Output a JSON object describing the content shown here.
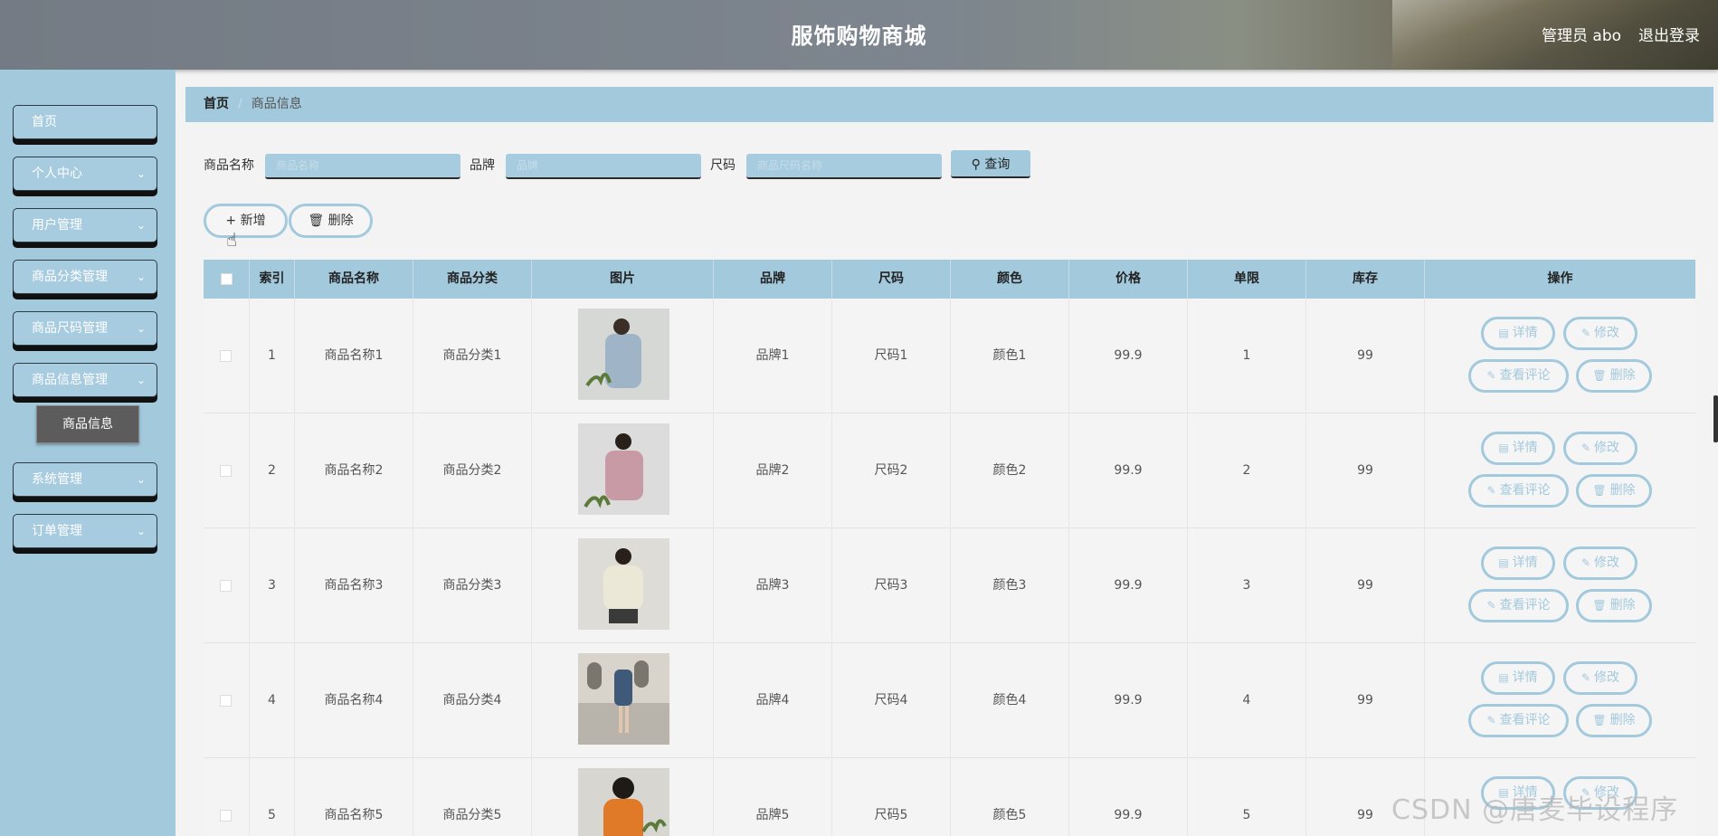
{
  "header": {
    "title": "服饰购物商城",
    "user": "管理员 abo",
    "logout": "退出登录"
  },
  "sidebar": {
    "items": [
      {
        "label": "首页",
        "has_children": false
      },
      {
        "label": "个人中心",
        "has_children": true
      },
      {
        "label": "用户管理",
        "has_children": true
      },
      {
        "label": "商品分类管理",
        "has_children": true
      },
      {
        "label": "商品尺码管理",
        "has_children": true
      },
      {
        "label": "商品信息管理",
        "has_children": true
      },
      {
        "label": "系统管理",
        "has_children": true
      },
      {
        "label": "订单管理",
        "has_children": true
      }
    ],
    "active_sub": "商品信息"
  },
  "breadcrumb": {
    "home": "首页",
    "separator": "/",
    "current": "商品信息"
  },
  "search": {
    "name_label": "商品名称",
    "name_placeholder": "商品名称",
    "brand_label": "品牌",
    "brand_placeholder": "品牌",
    "size_label": "尺码",
    "size_placeholder": "商品尺码名称",
    "query_button": "查询"
  },
  "actions": {
    "add": "新增",
    "delete": "删除"
  },
  "table": {
    "columns": [
      "索引",
      "商品名称",
      "商品分类",
      "图片",
      "品牌",
      "尺码",
      "颜色",
      "价格",
      "单限",
      "库存",
      "操作"
    ],
    "ops": {
      "detail": "详情",
      "edit": "修改",
      "comments": "查看评论",
      "delete": "删除"
    },
    "rows": [
      {
        "index": "1",
        "name": "商品名称1",
        "category": "商品分类1",
        "brand": "品牌1",
        "size": "尺码1",
        "color": "颜色1",
        "price": "99.9",
        "limit": "1",
        "stock": "99"
      },
      {
        "index": "2",
        "name": "商品名称2",
        "category": "商品分类2",
        "brand": "品牌2",
        "size": "尺码2",
        "color": "颜色2",
        "price": "99.9",
        "limit": "2",
        "stock": "99"
      },
      {
        "index": "3",
        "name": "商品名称3",
        "category": "商品分类3",
        "brand": "品牌3",
        "size": "尺码3",
        "color": "颜色3",
        "price": "99.9",
        "limit": "3",
        "stock": "99"
      },
      {
        "index": "4",
        "name": "商品名称4",
        "category": "商品分类4",
        "brand": "品牌4",
        "size": "尺码4",
        "color": "颜色4",
        "price": "99.9",
        "limit": "4",
        "stock": "99"
      },
      {
        "index": "5",
        "name": "商品名称5",
        "category": "商品分类5",
        "brand": "品牌5",
        "size": "尺码5",
        "color": "颜色5",
        "price": "99.9",
        "limit": "5",
        "stock": "99"
      }
    ]
  },
  "watermark": "CSDN @唐麦毕设程序",
  "colors": {
    "accent": "#a3c9dd",
    "header": "#7d858e",
    "submenu": "#5c5c5c"
  }
}
